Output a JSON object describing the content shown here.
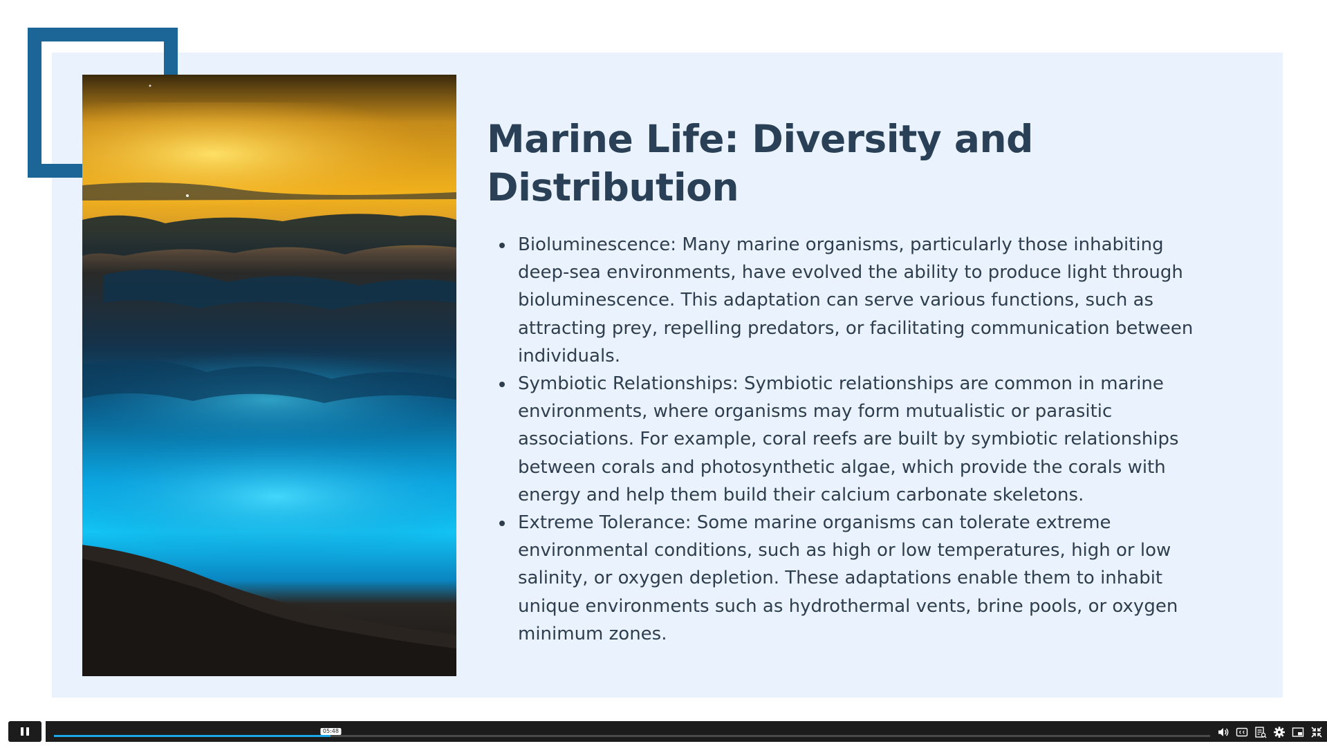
{
  "slide": {
    "title": "Marine Life: Diversity and Distribution",
    "bullets": [
      {
        "text": "Bioluminescence: Many marine organisms, particularly those inhabiting deep-sea environments, have evolved the ability to produce light through bioluminescence. This adaptation can serve various functions, such as attracting prey, repelling predators, or facilitating communication between individuals."
      },
      {
        "text": "Symbiotic Relationships: Symbiotic relationships are common in marine environments, where organisms may form mutualistic or parasitic associations. For example, coral reefs are built by symbiotic relationships between corals and photosynthetic algae, which provide the corals with energy and help them build their calcium carbonate skeletons."
      },
      {
        "text": "Extreme Tolerance: Some marine organisms can tolerate extreme environmental conditions, such as high or low temperatures, high or low salinity, or oxygen depletion. These adaptations enable them to inhabit unique environments such as hydrothermal vents, brine pools, or oxygen minimum zones."
      }
    ],
    "colors": {
      "background": "#eaf3fd",
      "accent_frame": "#1b6696",
      "title": "#2a4056",
      "body_text": "#2e3e4e"
    }
  },
  "player": {
    "state": "playing",
    "current_time": "05:48",
    "progress_fraction": 0.2395,
    "colors": {
      "bar": "#1c1c1c",
      "progress": "#1aa8e8"
    },
    "icons": [
      "pause-icon",
      "volume-icon",
      "captions-icon",
      "transcript-icon",
      "settings-icon",
      "picture-in-picture-icon",
      "exit-fullscreen-icon"
    ]
  }
}
